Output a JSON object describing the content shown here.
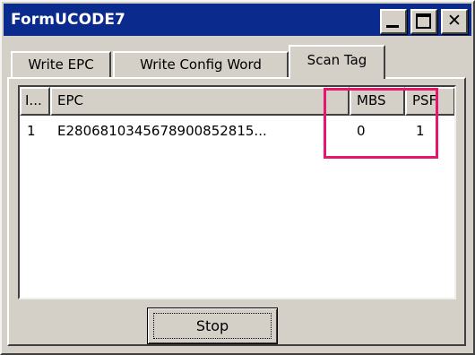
{
  "window": {
    "title": "FormUCODE7",
    "controls": {
      "minimize_icon": "minimize-icon",
      "maximize_icon": "maximize-icon",
      "close_icon": "close-icon",
      "close_glyph": "✕"
    }
  },
  "tabs": [
    {
      "label": "Write EPC",
      "selected": false
    },
    {
      "label": "Write Config Word",
      "selected": false
    },
    {
      "label": "Scan Tag",
      "selected": true
    }
  ],
  "table": {
    "columns": [
      "I...",
      "EPC",
      "MBS",
      "PSF"
    ],
    "rows": [
      {
        "index": "1",
        "epc": "E2806810345678900852815...",
        "mbs": "0",
        "psf": "1"
      }
    ]
  },
  "buttons": {
    "stop_label": "Stop"
  },
  "annotation": {
    "color": "#e8156f"
  },
  "colors": {
    "titlebar": "#0a2a8e",
    "face": "#d4d0c8"
  }
}
